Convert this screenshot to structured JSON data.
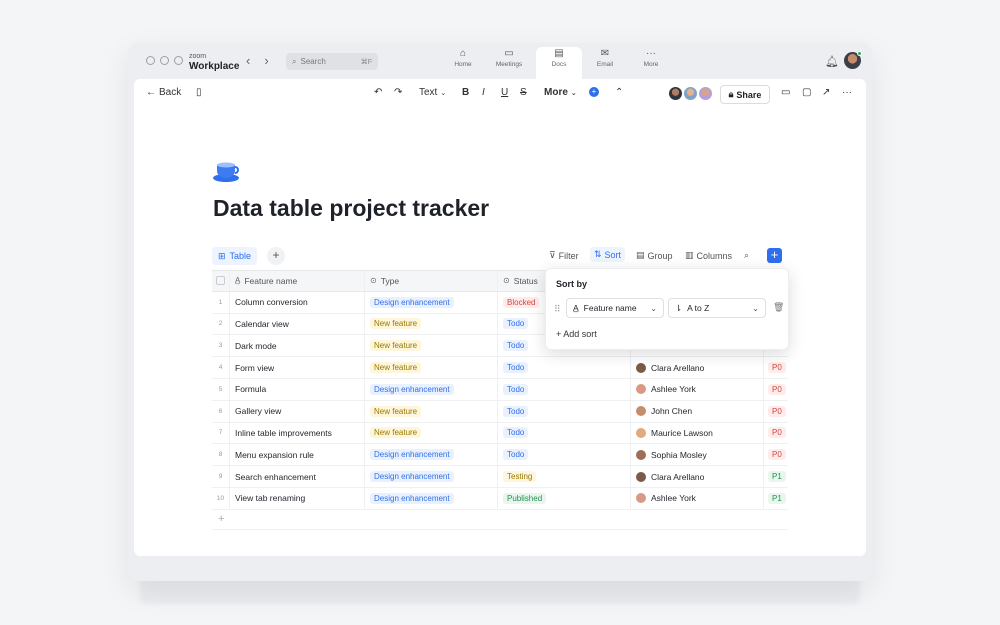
{
  "app": {
    "brand_small": "zoom",
    "brand_name": "Workplace",
    "search_placeholder": "Search",
    "search_shortcut": "⌘F",
    "nav_tabs": [
      {
        "label": "Home",
        "icon": "home-icon"
      },
      {
        "label": "Meetings",
        "icon": "calendar-icon"
      },
      {
        "label": "Docs",
        "icon": "document-icon"
      },
      {
        "label": "Email",
        "icon": "mail-icon"
      },
      {
        "label": "More",
        "icon": "more-icon"
      }
    ],
    "active_tab": "Docs"
  },
  "toolbar": {
    "back_label": "Back",
    "text_style": "Text",
    "format_bold": "B",
    "format_italic": "I",
    "format_underline": "U",
    "format_strike": "S",
    "more_label": "More",
    "share_label": "Share"
  },
  "doc": {
    "title": "Data table project tracker",
    "icon": "teacup-icon"
  },
  "table_controls": {
    "view_tab": "Table",
    "filter": "Filter",
    "sort": "Sort",
    "group": "Group",
    "columns": "Columns"
  },
  "table": {
    "columns": [
      "Feature name",
      "Type",
      "Status"
    ],
    "rows": [
      {
        "n": "1",
        "name": "Column conversion",
        "type": "Design enhancement",
        "status": "Blocked",
        "owner": "",
        "pri": ""
      },
      {
        "n": "2",
        "name": "Calendar view",
        "type": "New feature",
        "status": "Todo",
        "owner": "",
        "pri": ""
      },
      {
        "n": "3",
        "name": "Dark mode",
        "type": "New feature",
        "status": "Todo",
        "owner": "",
        "pri": ""
      },
      {
        "n": "4",
        "name": "Form view",
        "type": "New feature",
        "status": "Todo",
        "owner": "Clara Arellano",
        "pri": "P0"
      },
      {
        "n": "5",
        "name": "Formula",
        "type": "Design enhancement",
        "status": "Todo",
        "owner": "Ashlee York",
        "pri": "P0"
      },
      {
        "n": "6",
        "name": "Gallery view",
        "type": "New feature",
        "status": "Todo",
        "owner": "John Chen",
        "pri": "P0"
      },
      {
        "n": "7",
        "name": "Inline table improvements",
        "type": "New feature",
        "status": "Todo",
        "owner": "Maurice Lawson",
        "pri": "P0"
      },
      {
        "n": "8",
        "name": "Menu expansion rule",
        "type": "Design enhancement",
        "status": "Todo",
        "owner": "Sophia Mosley",
        "pri": "P0"
      },
      {
        "n": "9",
        "name": "Search enhancement",
        "type": "Design enhancement",
        "status": "Testing",
        "owner": "Clara Arellano",
        "pri": "P1"
      },
      {
        "n": "10",
        "name": "View tab renaming",
        "type": "Design enhancement",
        "status": "Published",
        "owner": "Ashlee York",
        "pri": "P1"
      }
    ],
    "add_row": "+"
  },
  "sort_popup": {
    "title": "Sort by",
    "field": "Feature name",
    "order": "A to Z",
    "add_sort": "Add sort"
  },
  "colors": {
    "accent": "#2f6fed",
    "blocked": "#d64541",
    "published": "#1f9350"
  }
}
